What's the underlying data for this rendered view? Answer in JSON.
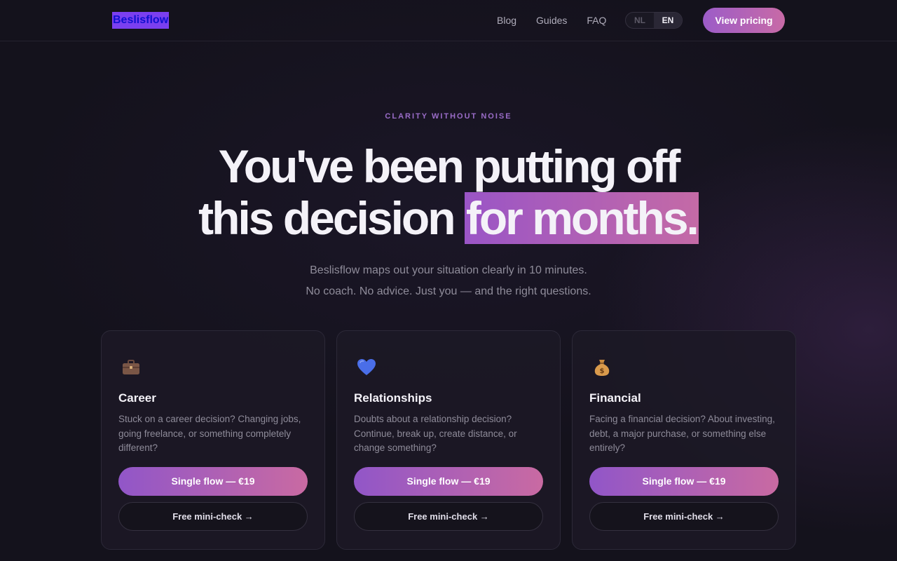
{
  "nav": {
    "logo": "Beslisflow",
    "links": [
      "Blog",
      "Guides",
      "FAQ"
    ],
    "lang": {
      "nl": "NL",
      "en": "EN",
      "selected": "EN"
    },
    "cta": "View pricing"
  },
  "hero": {
    "eyebrow": "CLARITY WITHOUT NOISE",
    "headline_line1": "You've been putting off",
    "headline_line2_plain": "this decision ",
    "headline_line2_highlight": "for months.",
    "sub_line1": "Beslisflow maps out your situation clearly in 10 minutes.",
    "sub_line2": "No coach. No advice. Just you — and the right questions."
  },
  "cards": [
    {
      "icon": "briefcase-icon",
      "title": "Career",
      "desc": "Stuck on a career decision? Changing jobs, going freelance, or something completely different?",
      "primary": "Single flow — €19",
      "secondary": "Free mini-check →"
    },
    {
      "icon": "heart-icon",
      "title": "Relationships",
      "desc": "Doubts about a relationship decision? Continue, break up, create distance, or change something?",
      "primary": "Single flow — €19",
      "secondary": "Free mini-check →"
    },
    {
      "icon": "money-bag-icon",
      "title": "Financial",
      "desc": "Facing a financial decision? About investing, debt, a major purchase, or something else entirely?",
      "primary": "Single flow — €19",
      "secondary": "Free mini-check →"
    }
  ],
  "colors": {
    "background": "#14121c",
    "accent_start": "#9a55c6",
    "accent_end": "#c46aa6",
    "eyebrow": "#9a6cc8"
  }
}
